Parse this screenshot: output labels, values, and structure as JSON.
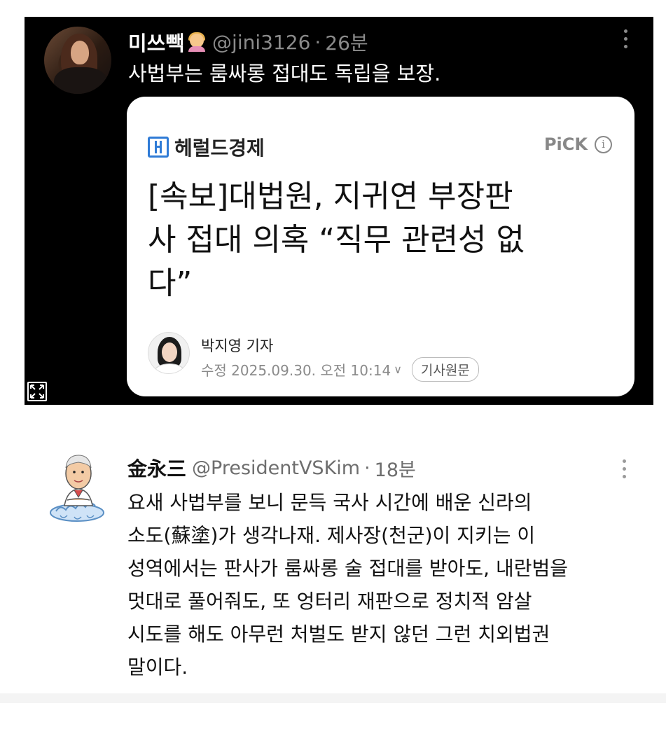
{
  "top_tweet": {
    "display_name": "미쓰빽",
    "handle": "@jini3126",
    "separator": "·",
    "time": "26분",
    "text": "사법부는 룸싸롱 접대도 독립을 보장.",
    "avatar_icon": "profile-photo",
    "emoji_icon": "person-facepalming-emoji",
    "menu_icon": "more-vertical-icon",
    "expand_icon": "expand-icon",
    "article_card": {
      "publisher": "헤럴드경제",
      "publisher_logo_icon": "herald-logo-icon",
      "pick_label": "PiCK",
      "info_glyph": "i",
      "headline_lines": [
        "[속보]대법원, 지귀연 부장판",
        "사 접대 의혹 “직무 관련성 없",
        "다”"
      ],
      "reporter_name": "박지영 기자",
      "edited": "수정 2025.09.30. 오전 10:14",
      "chevron": "∨",
      "original_article_button": "기사원문"
    }
  },
  "bottom_tweet": {
    "display_name": "金永三",
    "handle": "@PresidentVSKim",
    "separator": "·",
    "time": "18분",
    "avatar_icon": "cartoon-avatar-on-cloud",
    "menu_icon": "more-vertical-icon",
    "text_lines": [
      "요새 사법부를 보니 문득  국사 시간에 배운 신라의",
      "소도(蘇塗)가 생각나재. 제사장(천군)이 지키는 이",
      "성역에서는 판사가 룸싸롱 술 접대를 받아도, 내란범을",
      "멋대로 풀어줘도, 또 엉터리 재판으로 정치적 암살",
      "시도를 해도 아무런 처벌도 받지 않던 그런 치외법권",
      "말이다."
    ]
  },
  "colors": {
    "dark_background": "#000000",
    "secondary_text": "#8b8b8b",
    "herald_blue": "#2f7bd6"
  }
}
